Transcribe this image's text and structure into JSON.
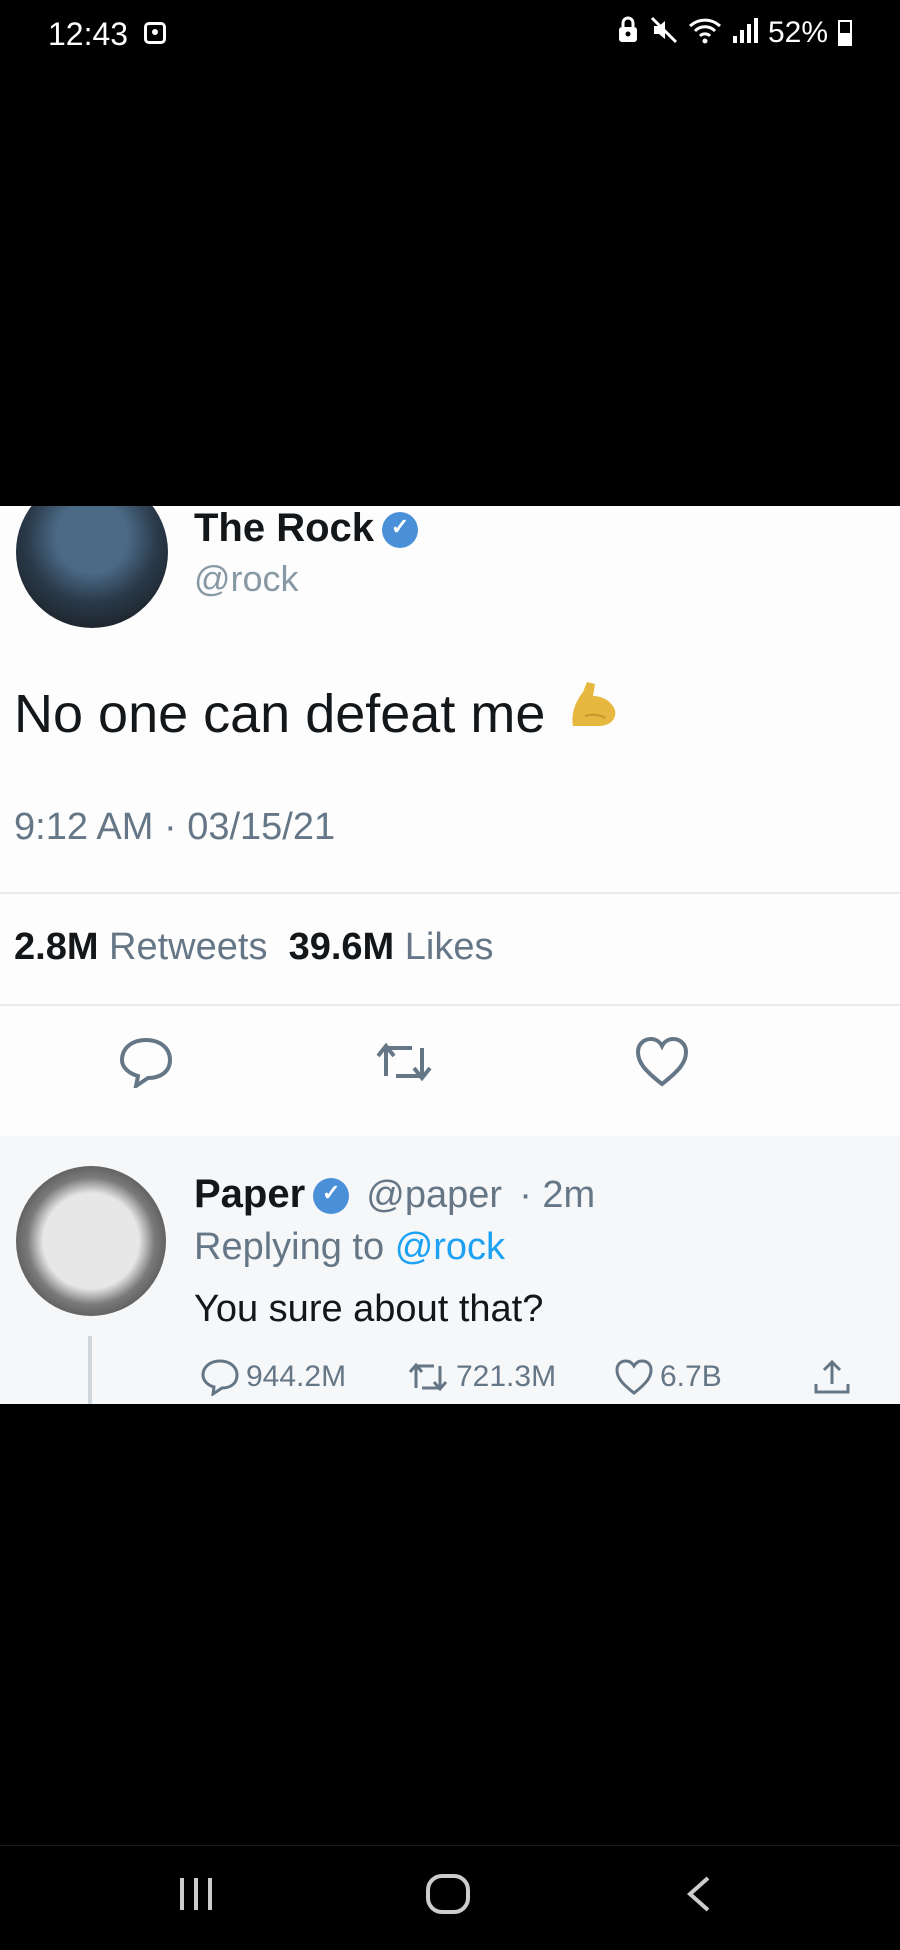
{
  "status_bar": {
    "time": "12:43",
    "battery": "52%",
    "icons": [
      "notification-icon",
      "lock-icon",
      "mute-icon",
      "wifi-icon",
      "signal-icon",
      "battery-icon"
    ]
  },
  "tweet": {
    "author_name": "The Rock",
    "handle": "@rock",
    "text": "No one can defeat me",
    "emoji": "flexed-biceps",
    "timestamp": "9:12 AM · 03/15/21",
    "retweets_count": "2.8M",
    "retweets_label": "Retweets",
    "likes_count": "39.6M",
    "likes_label": "Likes"
  },
  "reply": {
    "author_name": "Paper",
    "handle": "@paper",
    "time": "· 2m",
    "replying_prefix": "Replying to",
    "replying_to": "@rock",
    "text": "You sure about that?",
    "replies": "944.2M",
    "retweets": "721.3M",
    "likes": "6.7B"
  },
  "colors": {
    "verified": "#4a90d9",
    "link": "#1da1f2",
    "muted_text": "#657786"
  }
}
